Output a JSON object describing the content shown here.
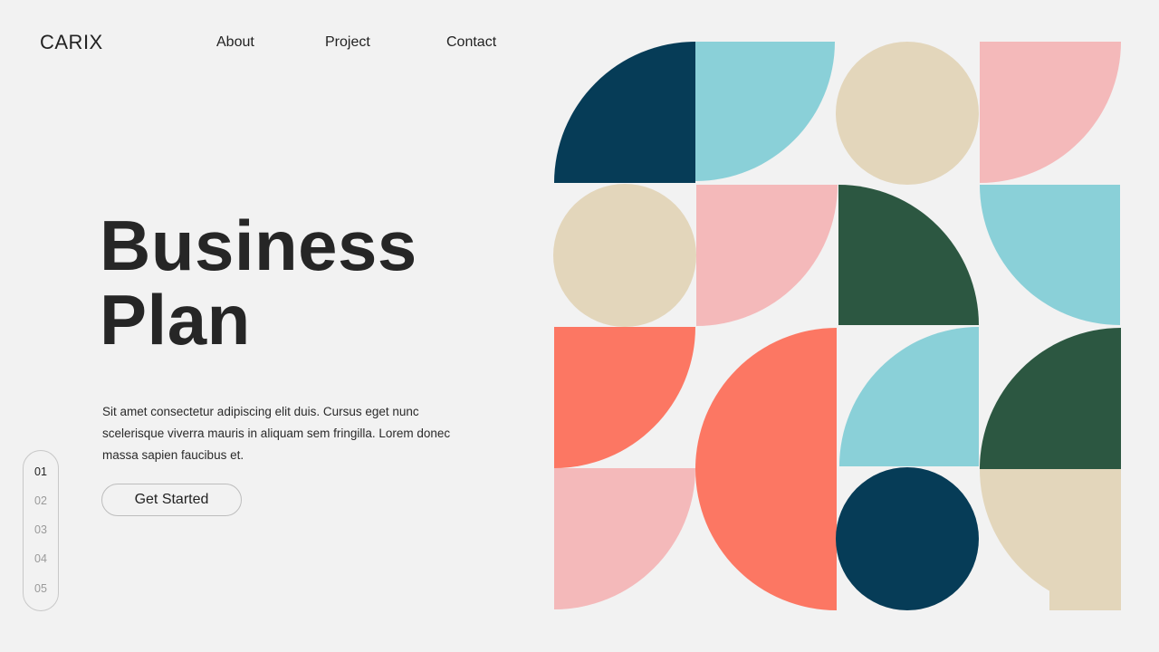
{
  "brand": {
    "name": "CARIX"
  },
  "nav": {
    "items": [
      {
        "label": "About"
      },
      {
        "label": "Project"
      },
      {
        "label": "Contact"
      }
    ]
  },
  "hero": {
    "title_line1": "Business",
    "title_line2": "Plan",
    "description": "Sit amet consectetur adipiscing elit duis. Cursus eget nunc scelerisque viverra mauris in aliquam sem fringilla. Lorem donec massa sapien faucibus et.",
    "cta_label": "Get Started"
  },
  "pager": {
    "active": "01",
    "pages": [
      {
        "label": "01"
      },
      {
        "label": "02"
      },
      {
        "label": "03"
      },
      {
        "label": "04"
      },
      {
        "label": "05"
      }
    ]
  },
  "palette": {
    "background": "#f2f2f2",
    "navy": "#063c57",
    "teal": "#8ad0d8",
    "sand": "#e3d6bb",
    "pink": "#f4b9ba",
    "forest": "#2c5741",
    "coral": "#fc7763"
  },
  "artwork": {
    "shapes": [
      {
        "kind": "quarter-circle",
        "color": "navy"
      },
      {
        "kind": "quarter-circle",
        "color": "teal"
      },
      {
        "kind": "circle",
        "color": "sand"
      },
      {
        "kind": "quarter-circle",
        "color": "pink"
      },
      {
        "kind": "circle",
        "color": "sand"
      },
      {
        "kind": "quarter-circle",
        "color": "pink"
      },
      {
        "kind": "quarter-circle",
        "color": "forest"
      },
      {
        "kind": "quarter-circle",
        "color": "teal"
      },
      {
        "kind": "quarter-circle",
        "color": "coral"
      },
      {
        "kind": "half-circle",
        "color": "coral"
      },
      {
        "kind": "quarter-circle",
        "color": "teal"
      },
      {
        "kind": "quarter-circle",
        "color": "forest"
      },
      {
        "kind": "quarter-circle",
        "color": "pink"
      },
      {
        "kind": "circle",
        "color": "navy"
      },
      {
        "kind": "quarter-circle",
        "color": "sand"
      },
      {
        "kind": "rectangle",
        "color": "sand"
      }
    ]
  }
}
